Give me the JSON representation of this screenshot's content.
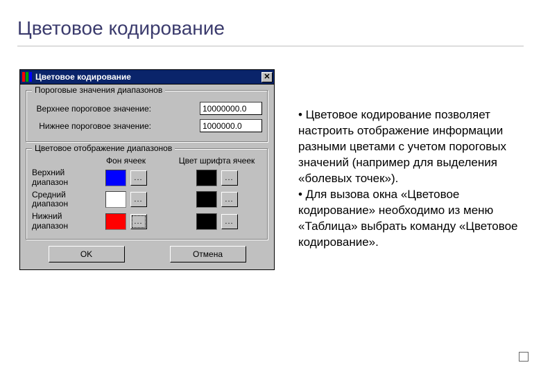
{
  "slide": {
    "title": "Цветовое кодирование"
  },
  "dialog": {
    "title": "Цветовое кодирование",
    "group_thresholds": {
      "legend": "Пороговые значения диапазонов",
      "upper_label": "Верхнее пороговое значение:",
      "upper_value": "10000000.0",
      "lower_label": "Нижнее пороговое значение:",
      "lower_value": "1000000.0"
    },
    "group_colors": {
      "legend": "Цветовое отображение диапазонов",
      "header_bg": "Фон ячеек",
      "header_font": "Цвет шрифта ячеек",
      "rows": [
        {
          "label": "Верхний диапазон",
          "bg": "#0000ff",
          "font": "#000000"
        },
        {
          "label": "Средний диапазон",
          "bg": "#ffffff",
          "font": "#000000"
        },
        {
          "label": "Нижний диапазон",
          "bg": "#ff0000",
          "font": "#000000"
        }
      ],
      "dots": "..."
    },
    "buttons": {
      "ok": "OK",
      "cancel": "Отмена"
    }
  },
  "explain": {
    "p1": "• Цветовое кодирование позволяет настроить отображение информации разными цветами с учетом пороговых значений (например для выделения «болевых точек»).",
    "p2": "• Для вызова окна «Цветовое кодирование» необходимо из меню «Таблица» выбрать команду «Цветовое кодирование»."
  }
}
